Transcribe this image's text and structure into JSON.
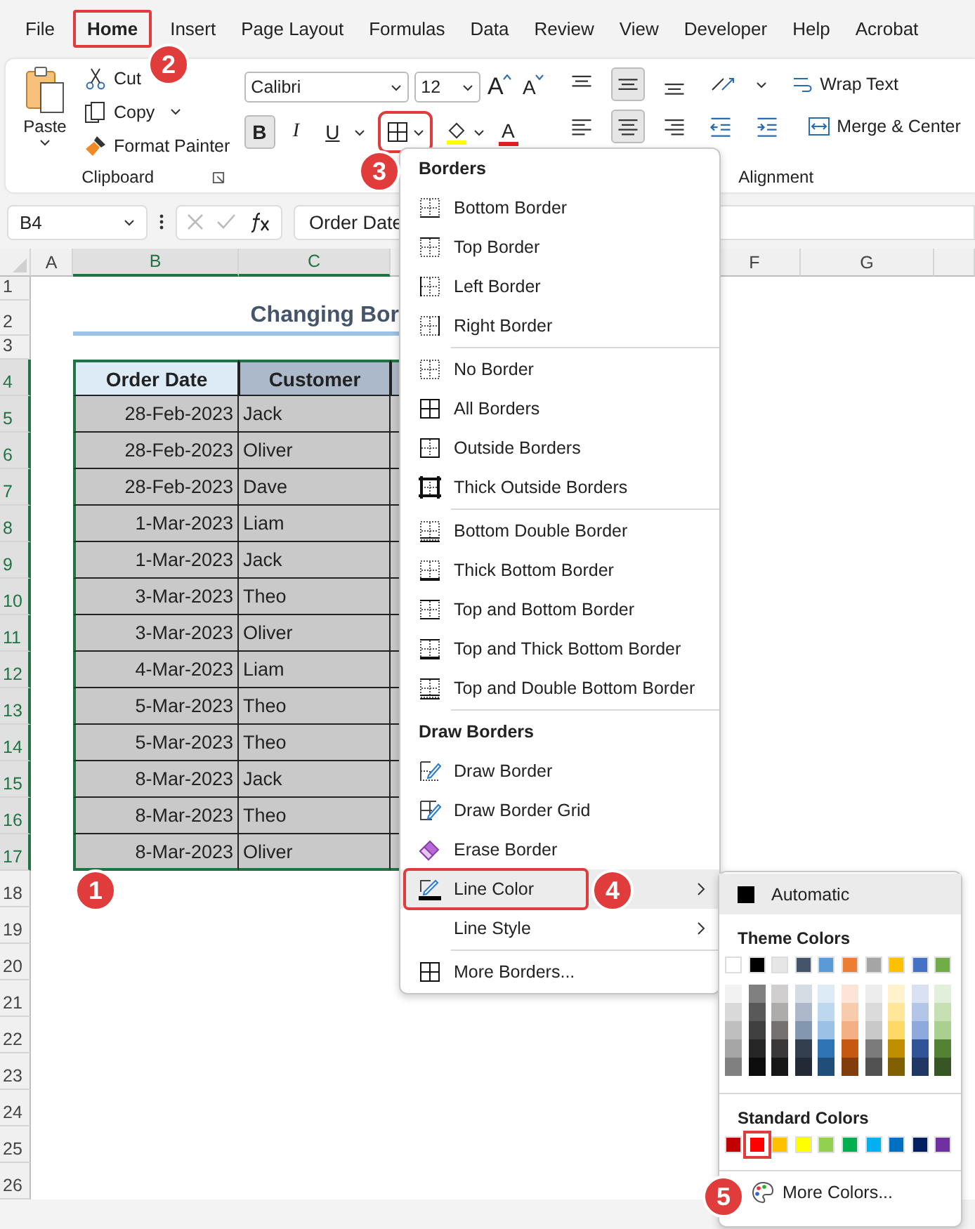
{
  "menu_tabs": [
    {
      "label": "File",
      "selected": false
    },
    {
      "label": "Home",
      "selected": true
    },
    {
      "label": "Insert",
      "selected": false
    },
    {
      "label": "Page Layout",
      "selected": false
    },
    {
      "label": "Formulas",
      "selected": false
    },
    {
      "label": "Data",
      "selected": false
    },
    {
      "label": "Review",
      "selected": false
    },
    {
      "label": "View",
      "selected": false
    },
    {
      "label": "Developer",
      "selected": false
    },
    {
      "label": "Help",
      "selected": false
    },
    {
      "label": "Acrobat",
      "selected": false
    }
  ],
  "ribbon": {
    "paste": "Paste",
    "cut": "Cut",
    "copy": "Copy",
    "format_painter": "Format Painter",
    "clipboard_label": "Clipboard",
    "font": "Calibri",
    "size": "12",
    "grow_font": "A",
    "shrink_font": "A",
    "bold": "B",
    "bold_active": true,
    "italic": "I",
    "underline": "U",
    "borders_active": true,
    "font_color": "A",
    "middle_align_active": true,
    "center_align_active": true,
    "wrap_text": "Wrap Text",
    "merge_center": "Merge & Center",
    "alignment_label": "Alignment"
  },
  "name_box": "B4",
  "formula": "Order Date",
  "columns": [
    {
      "label": "A",
      "selected": false
    },
    {
      "label": "B",
      "selected": true
    },
    {
      "label": "C",
      "selected": true
    },
    {
      "label": "F",
      "selected": false
    },
    {
      "label": "G",
      "selected": false
    }
  ],
  "sheet_rows": [
    {
      "label": "1",
      "selected": false
    },
    {
      "label": "2",
      "selected": false
    },
    {
      "label": "3",
      "selected": false
    },
    {
      "label": "4",
      "selected": true
    },
    {
      "label": "5",
      "selected": true
    },
    {
      "label": "6",
      "selected": true
    },
    {
      "label": "7",
      "selected": true
    },
    {
      "label": "8",
      "selected": true
    },
    {
      "label": "9",
      "selected": true
    },
    {
      "label": "10",
      "selected": true
    },
    {
      "label": "11",
      "selected": true
    },
    {
      "label": "12",
      "selected": true
    },
    {
      "label": "13",
      "selected": true
    },
    {
      "label": "14",
      "selected": true
    },
    {
      "label": "15",
      "selected": true
    },
    {
      "label": "16",
      "selected": true
    },
    {
      "label": "17",
      "selected": true
    },
    {
      "label": "18",
      "selected": false
    },
    {
      "label": "19",
      "selected": false
    },
    {
      "label": "20",
      "selected": false
    },
    {
      "label": "21",
      "selected": false
    },
    {
      "label": "22",
      "selected": false
    },
    {
      "label": "23",
      "selected": false
    },
    {
      "label": "24",
      "selected": false
    },
    {
      "label": "25",
      "selected": false
    },
    {
      "label": "26",
      "selected": false
    }
  ],
  "title": "Changing Bor",
  "table": {
    "columns": [
      "Order Date",
      "Customer"
    ],
    "rows": [
      [
        "28-Feb-2023",
        "Jack"
      ],
      [
        "28-Feb-2023",
        "Oliver"
      ],
      [
        "28-Feb-2023",
        "Dave"
      ],
      [
        "1-Mar-2023",
        "Liam"
      ],
      [
        "1-Mar-2023",
        "Jack"
      ],
      [
        "3-Mar-2023",
        "Theo"
      ],
      [
        "3-Mar-2023",
        "Oliver"
      ],
      [
        "4-Mar-2023",
        "Liam"
      ],
      [
        "5-Mar-2023",
        "Theo"
      ],
      [
        "5-Mar-2023",
        "Theo"
      ],
      [
        "8-Mar-2023",
        "Jack"
      ],
      [
        "8-Mar-2023",
        "Theo"
      ],
      [
        "8-Mar-2023",
        "Oliver"
      ]
    ]
  },
  "borders_menu": {
    "sections": [
      {
        "heading": "Borders",
        "items": [
          {
            "label": "Bottom Border",
            "kind": "bottom",
            "highlighted": false,
            "submenu": false
          },
          {
            "label": "Top Border",
            "kind": "top",
            "highlighted": false,
            "submenu": false
          },
          {
            "label": "Left Border",
            "kind": "left",
            "highlighted": false,
            "submenu": false
          },
          {
            "label": "Right Border",
            "kind": "right",
            "highlighted": false,
            "submenu": false
          }
        ]
      },
      {
        "items": [
          {
            "label": "No Border",
            "kind": "none",
            "highlighted": false,
            "submenu": false
          },
          {
            "label": "All Borders",
            "kind": "all",
            "highlighted": false,
            "submenu": false
          },
          {
            "label": "Outside Borders",
            "kind": "outside",
            "highlighted": false,
            "submenu": false
          },
          {
            "label": "Thick Outside Borders",
            "kind": "thick-outside",
            "highlighted": false,
            "submenu": false
          }
        ]
      },
      {
        "items": [
          {
            "label": "Bottom Double Border",
            "kind": "bottom-double",
            "highlighted": false,
            "submenu": false
          },
          {
            "label": "Thick Bottom Border",
            "kind": "thick-bottom",
            "highlighted": false,
            "submenu": false
          },
          {
            "label": "Top and Bottom Border",
            "kind": "top-bottom",
            "highlighted": false,
            "submenu": false
          },
          {
            "label": "Top and Thick Bottom Border",
            "kind": "top-thick-bottom",
            "highlighted": false,
            "submenu": false
          },
          {
            "label": "Top and Double Bottom Border",
            "kind": "top-double-bottom",
            "highlighted": false,
            "submenu": false
          }
        ]
      },
      {
        "heading": "Draw Borders",
        "items": [
          {
            "label": "Draw Border",
            "kind": "draw",
            "highlighted": false,
            "submenu": false
          },
          {
            "label": "Draw Border Grid",
            "kind": "draw-grid",
            "highlighted": false,
            "submenu": false
          },
          {
            "label": "Erase Border",
            "kind": "erase",
            "highlighted": false,
            "submenu": false
          },
          {
            "label": "Line Color",
            "kind": "line-color",
            "highlighted": true,
            "submenu": true
          },
          {
            "label": "Line Style",
            "kind": "line-style",
            "highlighted": false,
            "submenu": true
          }
        ]
      },
      {
        "items": [
          {
            "label": "More Borders...",
            "kind": "all",
            "highlighted": false,
            "submenu": false
          }
        ]
      }
    ]
  },
  "line_color_menu": {
    "automatic": {
      "label": "Automatic",
      "highlighted": true
    },
    "theme_heading": "Theme Colors",
    "theme_colors": [
      {
        "color": "#ffffff"
      },
      {
        "color": "#000000"
      },
      {
        "color": "#e7e6e6"
      },
      {
        "color": "#44546a"
      },
      {
        "color": "#5b9bd5"
      },
      {
        "color": "#ed7d31"
      },
      {
        "color": "#a5a5a5"
      },
      {
        "color": "#ffc000"
      },
      {
        "color": "#4472c4"
      },
      {
        "color": "#70ad47"
      }
    ],
    "shades": [
      [
        {
          "color": "#f2f2f2"
        },
        {
          "color": "#d9d9d9"
        },
        {
          "color": "#bfbfbf"
        },
        {
          "color": "#a6a6a6"
        },
        {
          "color": "#808080"
        }
      ],
      [
        {
          "color": "#808080"
        },
        {
          "color": "#595959"
        },
        {
          "color": "#404040"
        },
        {
          "color": "#262626"
        },
        {
          "color": "#0d0d0d"
        }
      ],
      [
        {
          "color": "#d0cece"
        },
        {
          "color": "#aeabab"
        },
        {
          "color": "#757171"
        },
        {
          "color": "#3a3838"
        },
        {
          "color": "#171616"
        }
      ],
      [
        {
          "color": "#d6dce4"
        },
        {
          "color": "#adb9ca"
        },
        {
          "color": "#8497b0"
        },
        {
          "color": "#333f4f"
        },
        {
          "color": "#222a35"
        }
      ],
      [
        {
          "color": "#ddebf7"
        },
        {
          "color": "#bdd7ee"
        },
        {
          "color": "#9bc2e6"
        },
        {
          "color": "#2f75b5"
        },
        {
          "color": "#1f4e78"
        }
      ],
      [
        {
          "color": "#fce4d6"
        },
        {
          "color": "#f8cbad"
        },
        {
          "color": "#f4b084"
        },
        {
          "color": "#c65911"
        },
        {
          "color": "#833c0c"
        }
      ],
      [
        {
          "color": "#ededed"
        },
        {
          "color": "#dbdbdb"
        },
        {
          "color": "#c9c9c9"
        },
        {
          "color": "#7b7b7b"
        },
        {
          "color": "#525252"
        }
      ],
      [
        {
          "color": "#fff2cc"
        },
        {
          "color": "#ffe699"
        },
        {
          "color": "#ffd966"
        },
        {
          "color": "#bf8f00"
        },
        {
          "color": "#806000"
        }
      ],
      [
        {
          "color": "#d9e1f2"
        },
        {
          "color": "#b4c6e7"
        },
        {
          "color": "#8ea9db"
        },
        {
          "color": "#305496"
        },
        {
          "color": "#203764"
        }
      ],
      [
        {
          "color": "#e2efda"
        },
        {
          "color": "#c6e0b4"
        },
        {
          "color": "#a9d08e"
        },
        {
          "color": "#548235"
        },
        {
          "color": "#375623"
        }
      ]
    ],
    "standard_heading": "Standard Colors",
    "standard_colors": [
      {
        "color": "#c00000",
        "selected": false
      },
      {
        "color": "#ff0000",
        "selected": true
      },
      {
        "color": "#ffc000",
        "selected": false
      },
      {
        "color": "#ffff00",
        "selected": false
      },
      {
        "color": "#92d050",
        "selected": false
      },
      {
        "color": "#00b050",
        "selected": false
      },
      {
        "color": "#00b0f0",
        "selected": false
      },
      {
        "color": "#0070c0",
        "selected": false
      },
      {
        "color": "#002060",
        "selected": false
      },
      {
        "color": "#7030a0",
        "selected": false
      }
    ],
    "more_colors": "More Colors..."
  },
  "callouts": [
    "1",
    "2",
    "3",
    "4",
    "5"
  ]
}
